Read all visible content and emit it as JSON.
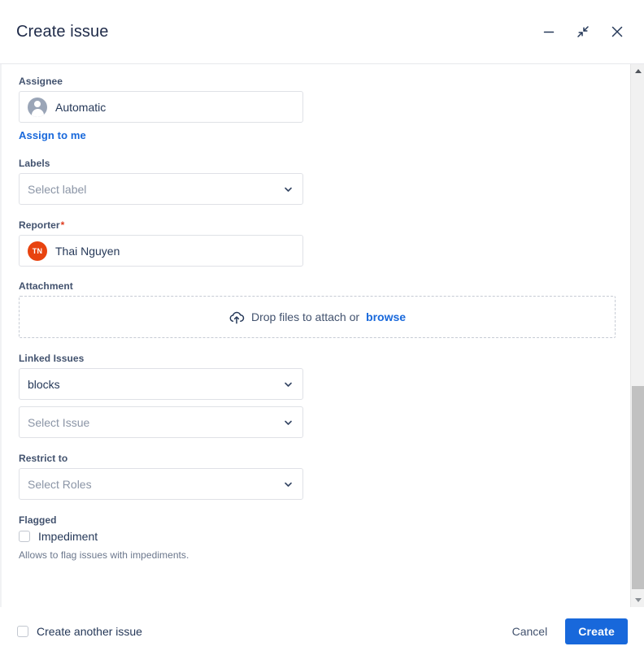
{
  "dialog": {
    "title": "Create issue",
    "window_controls": [
      {
        "name": "minimize-icon",
        "label": "Minimize"
      },
      {
        "name": "collapse-icon",
        "label": "Collapse"
      },
      {
        "name": "close-icon",
        "label": "Close"
      }
    ]
  },
  "colors": {
    "primary": "#1868db",
    "link": "#1868db",
    "required_star": "#de3b1f",
    "avatar_reporter_bg": "#e8430f",
    "avatar_generic_bg": "#9aa5b7",
    "label_text": "#42526e",
    "value_text": "#253858",
    "placeholder_text": "#8b95a6",
    "field_border": "#dfe1e6",
    "dropzone_border": "#c6cbd4",
    "scrollbar_track": "#f1f1f1",
    "scrollbar_thumb": "#c1c1c1"
  },
  "fields": {
    "assignee": {
      "label": "Assignee",
      "value": "Automatic",
      "avatar_icon": "person-avatar-icon",
      "assign_to_me": "Assign to me"
    },
    "labels": {
      "label": "Labels",
      "placeholder": "Select label",
      "value": "Select label"
    },
    "reporter": {
      "label": "Reporter",
      "required": "*",
      "value": "Thai Nguyen",
      "avatar_initials": "TN"
    },
    "attachment": {
      "label": "Attachment",
      "drop_text": "Drop files to attach or",
      "browse_text": "browse",
      "icon": "cloud-upload-icon"
    },
    "linked_issues": {
      "label": "Linked Issues",
      "link_type_value": "blocks",
      "issue_placeholder": "Select Issue",
      "issue_value": "Select Issue"
    },
    "restrict_to": {
      "label": "Restrict to",
      "placeholder": "Select Roles",
      "value": "Select Roles"
    },
    "flagged": {
      "label": "Flagged",
      "checkbox_label": "Impediment",
      "checked": false,
      "help_text": "Allows to flag issues with impediments."
    }
  },
  "footer": {
    "create_another_label": "Create another issue",
    "create_another_checked": false,
    "cancel_label": "Cancel",
    "create_label": "Create"
  },
  "scrollbar": {
    "up_arrow": "scroll-up-arrow-icon",
    "down_arrow": "scroll-down-arrow-icon"
  }
}
